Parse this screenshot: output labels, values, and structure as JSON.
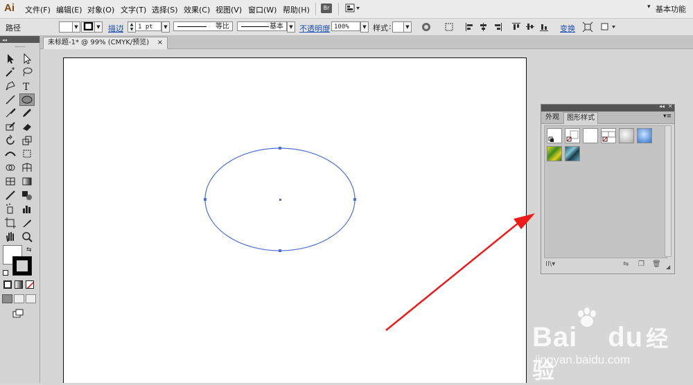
{
  "app": {
    "logo": "Ai"
  },
  "menubar": {
    "items": [
      "文件(F)",
      "编辑(E)",
      "对象(O)",
      "文字(T)",
      "选择(S)",
      "效果(C)",
      "视图(V)",
      "窗口(W)",
      "帮助(H)"
    ],
    "bridge_label": "Br",
    "workspace": "基本功能"
  },
  "control_bar": {
    "object_type": "路径",
    "stroke_label": "描边",
    "stroke_weight": "1 pt",
    "profile_label": "等比",
    "brush_label": "基本",
    "opacity_label": "不透明度",
    "opacity_value": "100%",
    "style_label": "样式",
    "transform_label": "变换"
  },
  "document": {
    "tab_title": "未标题-1* @ 99% (CMYK/预览)",
    "close_glyph": "×"
  },
  "graphic_styles_panel": {
    "tabs": [
      "外观",
      "图形样式"
    ],
    "selected_tab": "图形样式",
    "swatches": [
      "default",
      "default-no-fill",
      "plain",
      "no-fill-stroke",
      "gray-shadow",
      "blue-gradient",
      "green-texture",
      "blue-texture"
    ]
  },
  "watermark": {
    "brand": "Bai",
    "brand2": "du",
    "cn": "经验",
    "url": "jingyan.baidu.com"
  },
  "colors": {
    "selection_blue": "#4a6fd6",
    "arrow_red": "#ee1a1a",
    "link_blue": "#1b4fb1"
  }
}
